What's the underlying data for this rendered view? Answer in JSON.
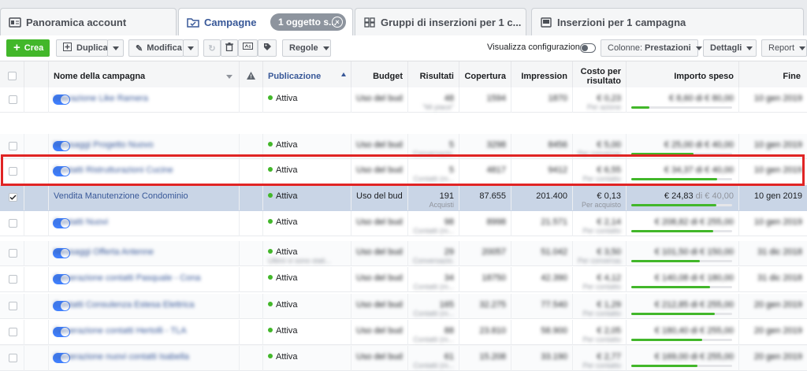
{
  "tabs": [
    {
      "label": "Panoramica account",
      "icon": "account-overview-icon"
    },
    {
      "label": "Campagne",
      "icon": "folder-check-icon"
    },
    {
      "label": "Gruppi di inserzioni per 1 c...",
      "icon": "grid-icon"
    },
    {
      "label": "Inserzioni per 1 campagna",
      "icon": "ad-icon"
    }
  ],
  "selection_pill": "1 oggetto s...",
  "toolbar": {
    "create_label": "Crea",
    "duplicate_label": "Duplica",
    "edit_label": "Modifica",
    "rules_label": "Regole",
    "view_config_label": "Visualizza configurazione",
    "columns_label": "Colonne:",
    "columns_value": "Prestazioni",
    "details_label": "Dettagli",
    "report_label": "Report"
  },
  "columns": {
    "name": "Nome della campagna",
    "delivery": "Publicazione",
    "budget": "Budget",
    "results": "Risultati",
    "reach": "Copertura",
    "impressions": "Impression",
    "cost_per_result": "Costo per risultato",
    "amount_spent": "Importo speso",
    "end": "Fine"
  },
  "rows": [
    {
      "name": "Interazione Like Ramera",
      "delivery": "Attiva",
      "delivery2": "",
      "budget": "Uso del bud...",
      "results": "48",
      "results_sub": "\"Mi piace\"",
      "reach": "1594",
      "impr": "1870",
      "cost": "€ 0,23",
      "cost_sub": "Per azione",
      "spent": "€ 8,60 di € 80,00",
      "progress": 0.18,
      "end": "10 gen 2019"
    },
    {
      "name": "Messaggi Progetto Nuovo",
      "delivery": "Attiva",
      "delivery2": "",
      "budget": "Uso del bud...",
      "results": "5",
      "results_sub": "Conversazio...",
      "reach": "3298",
      "impr": "8456",
      "cost": "€ 5,00",
      "cost_sub": "Per conversazione",
      "spent": "€ 25,00 di € 40,00",
      "progress": 0.62,
      "end": "10 gen 2019"
    },
    {
      "name": "Contatti Ristrutturazioni Cucine",
      "delivery": "Attiva",
      "delivery2": "",
      "budget": "Uso del bud...",
      "results": "5",
      "results_sub": "Contatti (m...",
      "reach": "4817",
      "impr": "9412",
      "cost": "€ 6,55",
      "cost_sub": "Per contatto",
      "spent": "€ 34,37 di € 40,00",
      "progress": 0.85,
      "end": "10 gen 2019"
    },
    {
      "name": "Vendita Manutenzione Condominio",
      "delivery": "Attiva",
      "delivery2": "",
      "budget": "Uso del bud...",
      "results": "191",
      "results_sub": "Acquisti",
      "reach": "87.655",
      "impr": "201.400",
      "cost": "€ 0,13",
      "cost_sub": "Per acquisto",
      "spent_a": "€ 24,83",
      "spent_b": "di € 40,00",
      "progress": 0.84,
      "end": "10 gen 2019",
      "selected": true
    },
    {
      "name": "Contatti Nuovi",
      "delivery": "Attiva",
      "delivery2": "",
      "budget": "Uso del bud...",
      "results": "98",
      "results_sub": "Contatti (m...",
      "reach": "8998",
      "impr": "21.571",
      "cost": "€ 2,14",
      "cost_sub": "Per contatto",
      "spent": "€ 208,82 di € 255,00",
      "progress": 0.81,
      "end": "10 gen 2019"
    },
    {
      "name": "Messaggi Offerta Antenne",
      "delivery": "Attiva",
      "delivery2": "Ultimi vi sono stati...",
      "budget": "Uso del bud...",
      "results": "29",
      "results_sub": "Conversazio...",
      "reach": "20057",
      "impr": "51.042",
      "cost": "€ 3,50",
      "cost_sub": "Per conversazione",
      "spent": "€ 101,50 di € 150,00",
      "progress": 0.68,
      "end": "31 dic 2018"
    },
    {
      "name": "Generazione contatti Pasquale - Cona",
      "delivery": "Attiva",
      "delivery2": "",
      "budget": "Uso del bud...",
      "results": "34",
      "results_sub": "Contatti (m...",
      "reach": "18750",
      "impr": "42.390",
      "cost": "€ 4,12",
      "cost_sub": "Per contatto",
      "spent": "€ 140,08 di € 180,00",
      "progress": 0.78,
      "end": "31 dic 2018"
    },
    {
      "name": "Contatti Consulenza Estesa Elettrica",
      "delivery": "Attiva",
      "delivery2": "",
      "budget": "Uso del bud...",
      "results": "165",
      "results_sub": "Contatti (m...",
      "reach": "32.275",
      "impr": "77.540",
      "cost": "€ 1,29",
      "cost_sub": "Per contatto",
      "spent": "€ 212,85 di € 255,00",
      "progress": 0.83,
      "end": "20 gen 2019"
    },
    {
      "name": "Generazione contatti Hertolli - TLA",
      "delivery": "Attiva",
      "delivery2": "",
      "budget": "Uso del bud...",
      "results": "88",
      "results_sub": "Contatti (m...",
      "reach": "23.810",
      "impr": "58.900",
      "cost": "€ 2,05",
      "cost_sub": "Per contatto",
      "spent": "€ 180,40 di € 255,00",
      "progress": 0.7,
      "end": "20 gen 2019"
    },
    {
      "name": "Generazione nuovi contatti Isabella",
      "delivery": "Attiva",
      "delivery2": "",
      "budget": "Uso del bud...",
      "results": "61",
      "results_sub": "Contatti (m...",
      "reach": "15.208",
      "impr": "33.190",
      "cost": "€ 2,77",
      "cost_sub": "Per contatto",
      "spent": "€ 169,00 di € 255,00",
      "progress": 0.66,
      "end": "20 gen 2019"
    }
  ],
  "colors": {
    "accent": "#385898",
    "green": "#42b72a",
    "highlight": "#e02424",
    "toggle": "#4080ff"
  }
}
